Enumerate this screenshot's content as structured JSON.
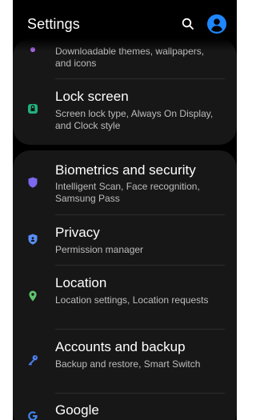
{
  "header": {
    "title": "Settings",
    "search_icon": "search-icon",
    "account_icon": "account-avatar-icon"
  },
  "colors": {
    "background": "#000000",
    "card": "#171717",
    "accent_blue": "#1e88ff",
    "lock_green": "#22b07d",
    "biometrics_violet": "#7b68ee",
    "privacy_blue": "#5b8ef7",
    "location_green": "#5ec46e",
    "accounts_blue": "#4f7ff0",
    "google_blue": "#4285f4"
  },
  "items": [
    {
      "title": "",
      "subtitle": "Downloadable themes, wallpapers, and icons",
      "icon": "themes-icon"
    },
    {
      "title": "Lock screen",
      "subtitle": "Screen lock type, Always On Display, and Clock style",
      "icon": "lock-icon"
    },
    {
      "title": "Biometrics and security",
      "subtitle": "Intelligent Scan, Face recognition, Samsung Pass",
      "icon": "shield-icon"
    },
    {
      "title": "Privacy",
      "subtitle": "Permission manager",
      "icon": "privacy-shield-icon"
    },
    {
      "title": "Location",
      "subtitle": "Location settings, Location requests",
      "icon": "location-pin-icon"
    },
    {
      "title": "Accounts and backup",
      "subtitle": "Backup and restore, Smart Switch",
      "icon": "key-icon"
    },
    {
      "title": "Google",
      "subtitle": "",
      "icon": "google-icon"
    }
  ]
}
